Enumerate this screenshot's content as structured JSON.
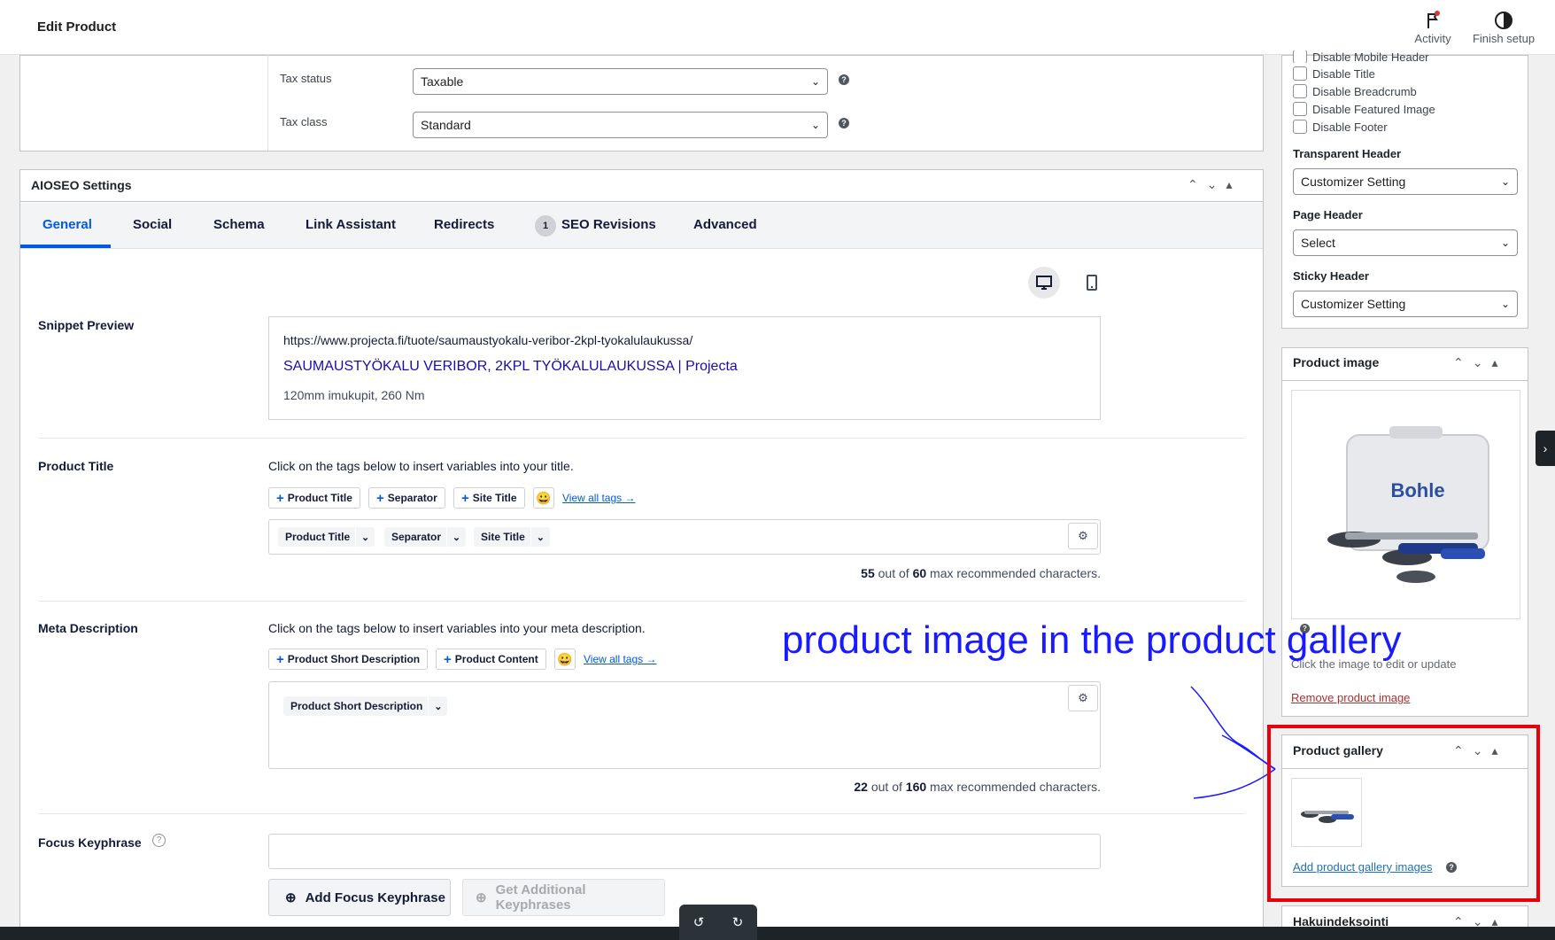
{
  "topbar": {
    "title": "Edit Product",
    "activity": "Activity",
    "finish_setup": "Finish setup"
  },
  "tax": {
    "status_label": "Tax status",
    "status_value": "Taxable",
    "class_label": "Tax class",
    "class_value": "Standard"
  },
  "aioseo": {
    "title": "AIOSEO Settings",
    "tabs": [
      "General",
      "Social",
      "Schema",
      "Link Assistant",
      "Redirects",
      "SEO Revisions",
      "Advanced"
    ],
    "revisions_count": "1",
    "snippet": {
      "label": "Snippet Preview",
      "url": "https://www.projecta.fi/tuote/saumaustyokalu-veribor-2kpl-tyokalulaukussa/",
      "title": "SAUMAUSTYÖKALU VERIBOR, 2KPL TYÖKALULAUKUSSA | Projecta",
      "desc": "120mm imukupit, 260 Nm"
    },
    "product_title": {
      "label": "Product Title",
      "hint": "Click on the tags below to insert variables into your title.",
      "tags": [
        "Product Title",
        "Separator",
        "Site Title"
      ],
      "view_all": "View all tags →",
      "chips": [
        "Product Title",
        "Separator",
        "Site Title"
      ],
      "count": "55",
      "max": "60",
      "count_suffix": "max recommended characters.",
      "out_of": "out of"
    },
    "meta": {
      "label": "Meta Description",
      "hint": "Click on the tags below to insert variables into your meta description.",
      "tags": [
        "Product Short Description",
        "Product Content"
      ],
      "view_all": "View all tags →",
      "chips": [
        "Product Short Description"
      ],
      "count": "22",
      "max": "160",
      "count_suffix": "max recommended characters.",
      "out_of": "out of"
    },
    "focus": {
      "label": "Focus Keyphrase",
      "add": "Add Focus Keyphrase",
      "get": "Get Additional Keyphrases"
    }
  },
  "sidebar": {
    "checkboxes": [
      "Disable Mobile Header",
      "Disable Title",
      "Disable Breadcrumb",
      "Disable Featured Image",
      "Disable Footer"
    ],
    "transparent_header": {
      "label": "Transparent Header",
      "value": "Customizer Setting"
    },
    "page_header": {
      "label": "Page Header",
      "value": "Select"
    },
    "sticky_header": {
      "label": "Sticky Header",
      "value": "Customizer Setting"
    },
    "product_image": {
      "title": "Product image",
      "hint": "Click the image to edit or update",
      "remove": "Remove product image",
      "brand": "Bohle"
    },
    "product_gallery": {
      "title": "Product gallery",
      "add": "Add product gallery images"
    },
    "next_panel": "Hakuindeksointi"
  },
  "annotation": {
    "text": "product image in the product gallery",
    "color": "#1a1aff",
    "box_color": "#e8000b"
  }
}
